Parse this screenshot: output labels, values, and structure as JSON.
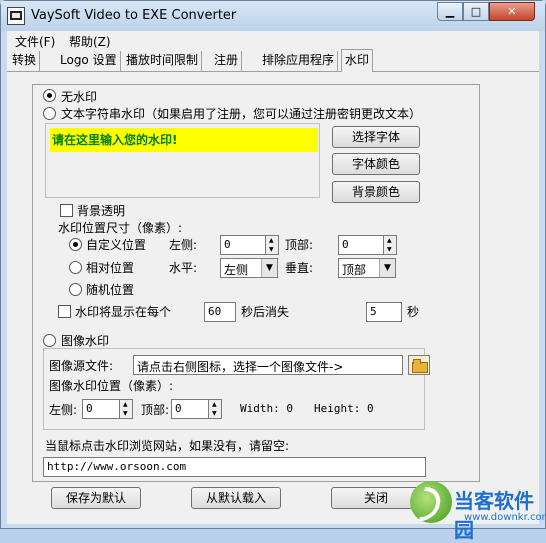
{
  "window": {
    "title": "VaySoft Video to EXE Converter",
    "controls": {
      "minimize": "▁",
      "maximize": "□",
      "close": "✕"
    }
  },
  "menu": [
    "文件(F)",
    "帮助(Z)"
  ],
  "tabs": [
    "转换",
    "Logo 设置",
    "播放时间限制",
    "注册",
    "排除应用程序",
    "水印"
  ],
  "watermark": {
    "no_watermark": "无水印",
    "text_watermark": "文本字符串水印（如果启用了注册，您可以通过注册密钥更改文本）",
    "text_value": "请在这里输入您的水印!",
    "select_font": "选择字体",
    "font_color": "字体颜色",
    "bg_color": "背景颜色",
    "transparent_bg": "背景透明",
    "position_label": "水印位置尺寸（像素）:",
    "custom_position": "自定义位置",
    "relative_position": "相对位置",
    "random_position": "随机位置",
    "left_label": "左侧:",
    "left_value": "0",
    "top_label": "顶部:",
    "top_value": "0",
    "horizontal_label": "水平:",
    "horizontal_value": "左侧",
    "vertical_label": "垂直:",
    "vertical_value": "顶部",
    "show_every": "水印将显示在每个",
    "interval_value": "60",
    "seconds_then_hide": "秒后消失",
    "duration_value": "5",
    "seconds": "秒",
    "image_watermark": "图像水印",
    "image_source_label": "图像源文件:",
    "image_source_value": "请点击右侧图标，选择一个图像文件->",
    "image_position_label": "图像水印位置（像素）:",
    "img_left_label": "左侧:",
    "img_left_value": "0",
    "img_top_label": "顶部:",
    "img_top_value": "0",
    "width_label": "Width: 0",
    "height_label": "Height: 0",
    "url_label": "当鼠标点击水印浏览网站，如果没有，请留空:",
    "url_value": "http://www.orsoon.com"
  },
  "buttons": {
    "save_default": "保存为默认",
    "load_default": "从默认载入",
    "close": "关闭"
  },
  "site_watermark": {
    "title": "当客软件园",
    "url": "www.downkr.com"
  }
}
